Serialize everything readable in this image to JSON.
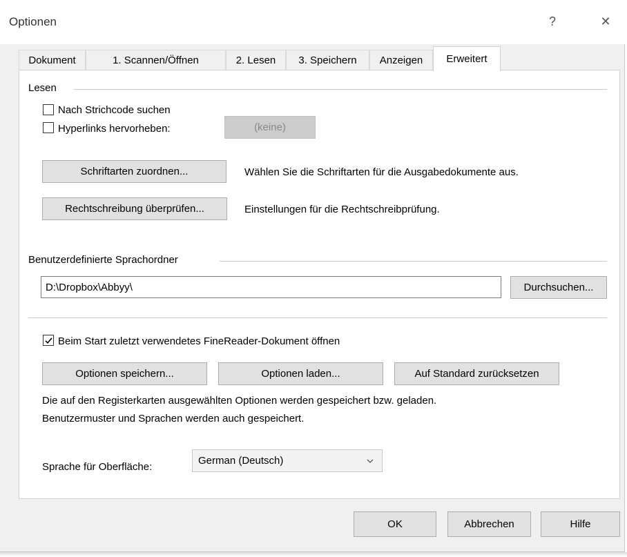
{
  "window": {
    "title": "Optionen",
    "help_glyph": "?",
    "close_glyph": "✕"
  },
  "tabs": [
    {
      "label": "Dokument",
      "active": false
    },
    {
      "label": "1. Scannen/Öffnen",
      "active": false
    },
    {
      "label": "2. Lesen",
      "active": false
    },
    {
      "label": "3. Speichern",
      "active": false
    },
    {
      "label": "Anzeigen",
      "active": false
    },
    {
      "label": "Erweitert",
      "active": true
    }
  ],
  "lesen": {
    "group_label": "Lesen",
    "barcode_label": "Nach Strichcode suchen",
    "barcode_checked": false,
    "hyperlinks_label": "Hyperlinks hervorheben:",
    "hyperlinks_checked": false,
    "hyperlinks_color_button": "(keine)",
    "fonts_button": "Schriftarten zuordnen...",
    "fonts_desc": "Wählen Sie die Schriftarten für die Ausgabedokumente aus.",
    "spell_button": "Rechtschreibung überprüfen...",
    "spell_desc": "Einstellungen für die Rechtschreibprüfung."
  },
  "languages": {
    "group_label": "Benutzerdefinierte Sprachordner",
    "path_value": "D:\\Dropbox\\Abbyy\\",
    "browse_button": "Durchsuchen..."
  },
  "misc": {
    "open_last_label": "Beim Start zuletzt verwendetes FineReader-Dokument öffnen",
    "open_last_checked": true,
    "save_options_button": "Optionen speichern...",
    "load_options_button": "Optionen laden...",
    "reset_button": "Auf Standard zurücksetzen",
    "info_line1": "Die auf den Registerkarten ausgewählten Optionen werden gespeichert bzw. geladen.",
    "info_line2": "Benutzermuster und Sprachen werden auch gespeichert.",
    "ui_language_label": "Sprache für Oberfläche:",
    "ui_language_value": "German (Deutsch)"
  },
  "footer": {
    "ok": "OK",
    "cancel": "Abbrechen",
    "help": "Hilfe"
  },
  "colors": {
    "dialog_bg": "#f0f0f0",
    "panel_bg": "#ffffff",
    "button_bg": "#e1e1e1"
  }
}
